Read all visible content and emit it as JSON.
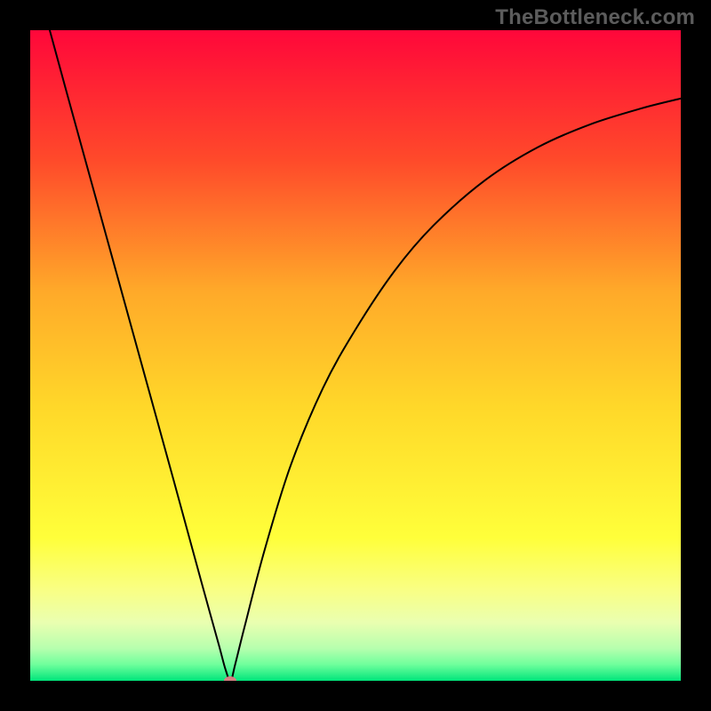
{
  "watermark": {
    "text": "TheBottleneck.com"
  },
  "chart_data": {
    "type": "line",
    "title": "",
    "xlabel": "",
    "ylabel": "",
    "xlim": [
      0,
      100
    ],
    "ylim": [
      0,
      100
    ],
    "grid": false,
    "legend": false,
    "gradient_stops": [
      {
        "offset": 0.0,
        "color": "#ff073a"
      },
      {
        "offset": 0.2,
        "color": "#ff4a2a"
      },
      {
        "offset": 0.4,
        "color": "#ffa929"
      },
      {
        "offset": 0.58,
        "color": "#ffd829"
      },
      {
        "offset": 0.78,
        "color": "#ffff3a"
      },
      {
        "offset": 0.86,
        "color": "#f9ff84"
      },
      {
        "offset": 0.91,
        "color": "#eaffb0"
      },
      {
        "offset": 0.95,
        "color": "#b7ffae"
      },
      {
        "offset": 0.975,
        "color": "#6fff9c"
      },
      {
        "offset": 1.0,
        "color": "#00e57b"
      }
    ],
    "series": [
      {
        "name": "bottleneck-curve",
        "x": [
          3,
          6,
          10,
          14,
          18,
          22,
          25,
          27,
          29,
          30,
          30.8,
          31.5,
          33,
          36,
          40,
          45,
          50,
          56,
          62,
          70,
          78,
          86,
          94,
          100
        ],
        "y": [
          100,
          89,
          74.5,
          60,
          45.5,
          31,
          20,
          12.7,
          5.5,
          1.8,
          0,
          2.5,
          8.5,
          20,
          33,
          45,
          54,
          63,
          70,
          77,
          82,
          85.5,
          88,
          89.5
        ]
      }
    ],
    "marker": {
      "x": 30.8,
      "y": 0,
      "color": "#d48082"
    }
  }
}
